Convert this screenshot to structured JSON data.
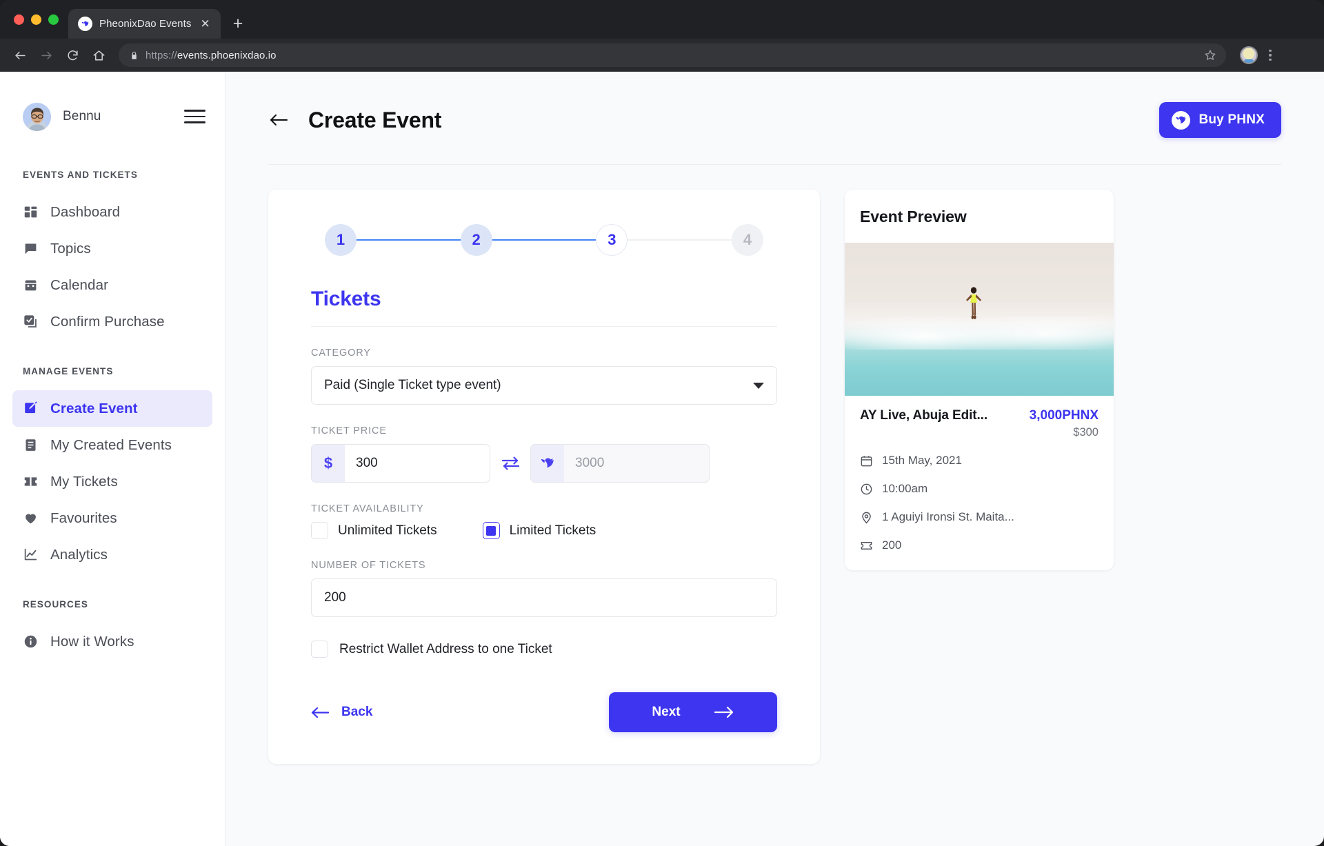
{
  "browser": {
    "tab_title": "PheonixDao Events",
    "tab_close": "✕",
    "new_tab": "+",
    "url_scheme": "https://",
    "url_host": "events.phoenixdao.io"
  },
  "sidebar": {
    "user": {
      "name": "Bennu"
    },
    "groups": [
      {
        "label": "EVENTS AND TICKETS",
        "items": [
          {
            "label": "Dashboard",
            "icon": "dashboard-icon",
            "active": false
          },
          {
            "label": "Topics",
            "icon": "topics-icon",
            "active": false
          },
          {
            "label": "Calendar",
            "icon": "calendar-icon",
            "active": false
          },
          {
            "label": "Confirm Purchase",
            "icon": "confirm-purchase-icon",
            "active": false
          }
        ]
      },
      {
        "label": "MANAGE EVENTS",
        "items": [
          {
            "label": "Create Event",
            "icon": "create-event-icon",
            "active": true
          },
          {
            "label": "My Created Events",
            "icon": "my-created-events-icon",
            "active": false
          },
          {
            "label": "My Tickets",
            "icon": "my-tickets-icon",
            "active": false
          },
          {
            "label": "Favourites",
            "icon": "favourites-icon",
            "active": false
          },
          {
            "label": "Analytics",
            "icon": "analytics-icon",
            "active": false
          }
        ]
      },
      {
        "label": "RESOURCES",
        "items": [
          {
            "label": "How it Works",
            "icon": "info-icon",
            "active": false
          }
        ]
      }
    ]
  },
  "header": {
    "title": "Create Event",
    "buy_button": "Buy PHNX"
  },
  "stepper": {
    "steps": [
      {
        "number": "1",
        "state": "done"
      },
      {
        "number": "2",
        "state": "done"
      },
      {
        "number": "3",
        "state": "current"
      },
      {
        "number": "4",
        "state": "todo"
      }
    ]
  },
  "form": {
    "section_title": "Tickets",
    "category_label": "CATEGORY",
    "category_value": "Paid (Single Ticket type event)",
    "ticket_price_label": "TICKET PRICE",
    "price_usd_symbol": "$",
    "price_usd_value": "300",
    "price_phnx_value": "3000",
    "availability_label": "TICKET AVAILABILITY",
    "unlimited_label": "Unlimited Tickets",
    "unlimited_checked": false,
    "limited_label": "Limited Tickets",
    "limited_checked": true,
    "number_label": "NUMBER OF TICKETS",
    "number_value": "200",
    "restrict_label": "Restrict Wallet Address to one Ticket",
    "restrict_checked": false,
    "back_label": "Back",
    "next_label": "Next"
  },
  "preview": {
    "heading": "Event Preview",
    "event_title": "AY Live, Abuja Edit...",
    "price_phnx": "3,000PHNX",
    "price_usd": "$300",
    "date": "15th May, 2021",
    "time": "10:00am",
    "location": "1 Aguiyi Ironsi St. Maita...",
    "capacity": "200"
  },
  "colors": {
    "accent": "#3d35ef",
    "accent_soft": "#eaeafc",
    "step_done": "#dce4f7",
    "line_filled": "#4285f4",
    "page_bg": "#f9fafc"
  }
}
